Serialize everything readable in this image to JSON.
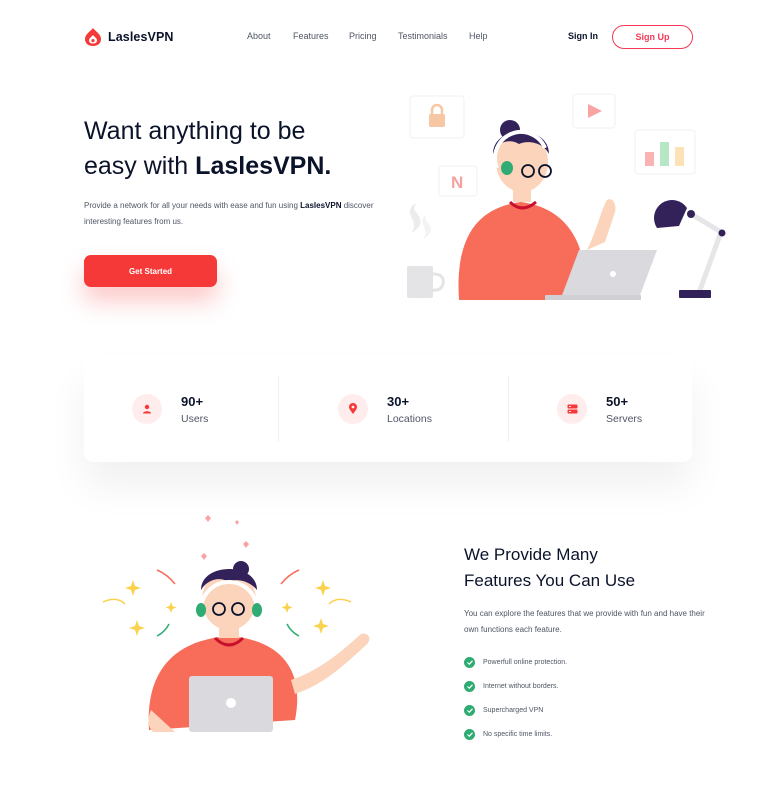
{
  "brand": {
    "name": "LaslesVPN",
    "color": "#f53838"
  },
  "nav": {
    "links": [
      "About",
      "Features",
      "Pricing",
      "Testimonials",
      "Help"
    ],
    "sign_in": "Sign In",
    "sign_up": "Sign Up"
  },
  "hero": {
    "title_line1": "Want anything to be",
    "title_line2_prefix": "easy with ",
    "title_line2_brand": "LaslesVPN.",
    "desc_part1": "Provide a network for all your needs with ease and fun using ",
    "desc_brand": "LaslesVPN",
    "desc_part2": " discover interesting features from us.",
    "cta": "Get Started"
  },
  "stats": [
    {
      "value": "90+",
      "label": "Users",
      "icon": "user-icon"
    },
    {
      "value": "30+",
      "label": "Locations",
      "icon": "location-pin-icon"
    },
    {
      "value": "50+",
      "label": "Servers",
      "icon": "server-icon"
    }
  ],
  "features": {
    "title_line1": "We Provide Many",
    "title_line2": "Features You Can Use",
    "desc": "You can explore the features that we provide with fun and have their own functions each feature.",
    "items": [
      "Powerfull online protection.",
      "Internet without borders.",
      "Supercharged VPN",
      "No specific time limits."
    ],
    "check_color": "#2fab73"
  }
}
